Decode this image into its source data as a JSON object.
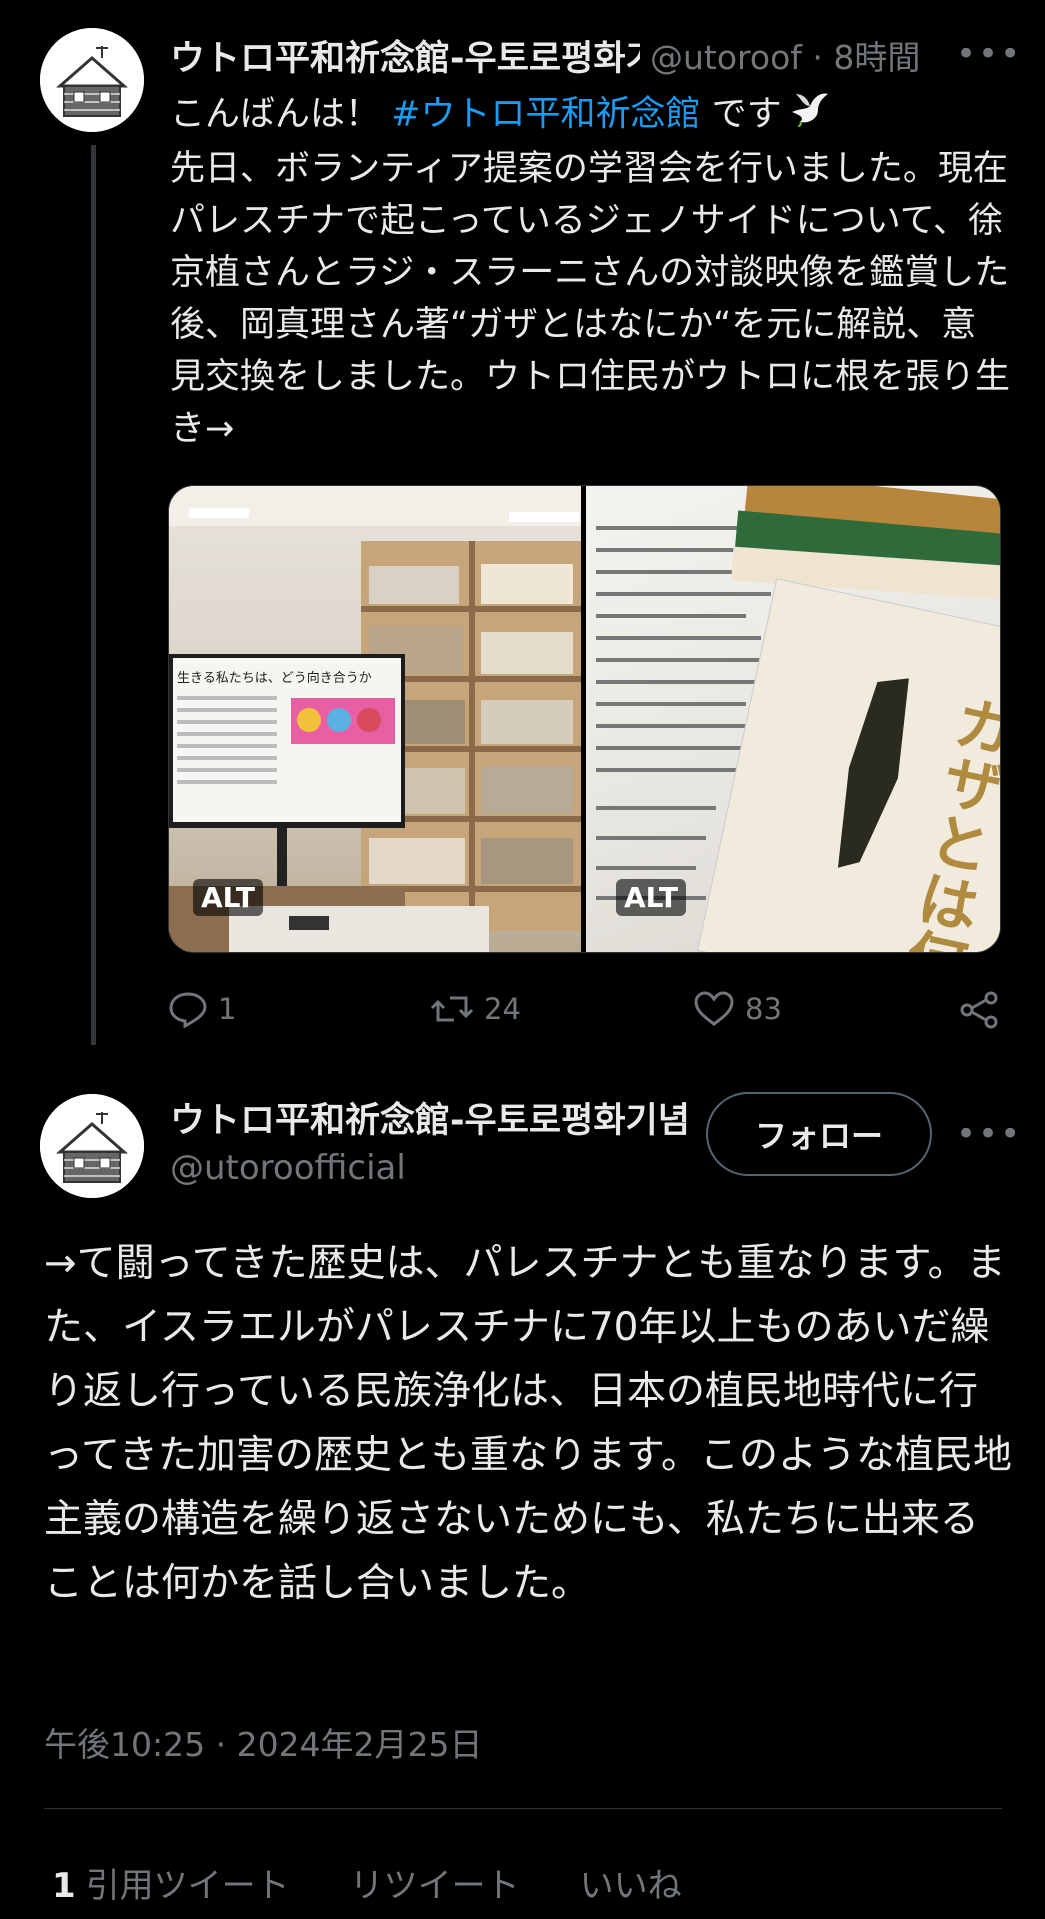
{
  "tweet1": {
    "display_name": "ウトロ平和祈念館-우토로평화기념관",
    "handle_time": "@utoroof · 8時間",
    "body": {
      "prefix": "こんばんは！ ",
      "hashtag": "#ウトロ平和祈念館",
      "suffix": " です",
      "rest": "先日、ボランティア提案の学習会を行いました。現在パレスチナで起こっているジェノサイドについて、徐京植さんとラジ・スラーニさんの対談映像を鑑賞した後、岡真理さん著“ガザとはなにか“を元に解説、意見交換をしました。ウトロ住民がウトロに根を張り生き→"
    },
    "images": [
      {
        "alt_badge": "ALT",
        "screen_text": "生きる私たちは、どう向き合うか",
        "icon": "photo-study-room"
      },
      {
        "alt_badge": "ALT",
        "book_title": "ガザとは何か",
        "icon": "photo-book-cover"
      }
    ],
    "actions": {
      "replies": "1",
      "retweets": "24",
      "likes": "83"
    }
  },
  "tweet2": {
    "display_name": "ウトロ平和祈念館-우토로평화기념관",
    "handle": "@utoroofficial",
    "follow_label": "フォロー",
    "body": "→て闘ってきた歴史は、パレスチナとも重なります。また、イスラエルがパレスチナに70年以上ものあいだ繰り返し行っている民族浄化は、日本の植民地時代に行ってきた加害の歴史とも重なります。このような植民地主義の構造を繰り返さないためにも、私たちに出来ることは何かを話し合いました。",
    "timestamp": "午後10:25 · 2024年2月25日"
  },
  "stats": {
    "quote_count": "1",
    "quote_label": "引用ツイート",
    "retweet_label": "リツイート",
    "like_label": "いいね"
  },
  "colors": {
    "background": "#000000",
    "text": "#e7e9ea",
    "secondary": "#71767b",
    "link": "#1d9bf0"
  }
}
